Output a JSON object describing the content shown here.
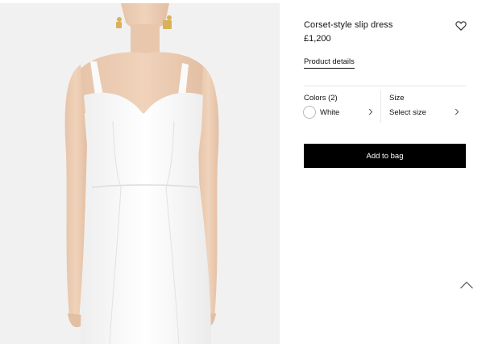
{
  "product": {
    "name": "Corset-style slip dress",
    "price": "£1,200",
    "details_link": "Product details",
    "image_alt": "White corset-style slip dress worn by model"
  },
  "options": {
    "colors_label": "Colors (2)",
    "selected_color": "White",
    "selected_color_hex": "#ffffff",
    "size_label": "Size",
    "size_value": "Select size"
  },
  "actions": {
    "add_to_bag": "Add to bag"
  },
  "icons": {
    "wishlist": "heart-icon",
    "chevron": "chevron-right-icon",
    "back_to_top": "chevron-up-icon"
  },
  "colors": {
    "accent": "#000000",
    "button_text": "#ffffff",
    "divider": "#e6e6e6",
    "image_background": "#f1f1f1"
  }
}
